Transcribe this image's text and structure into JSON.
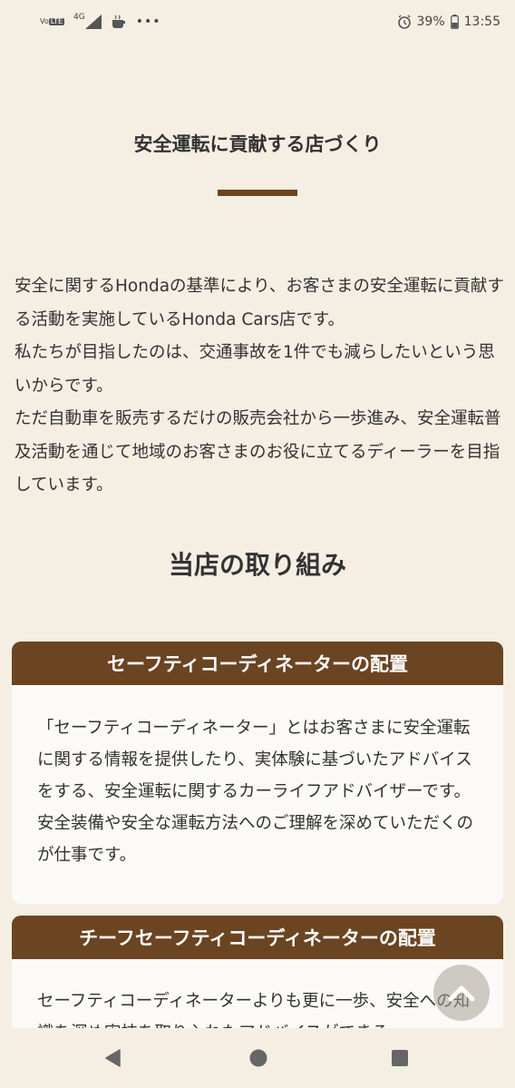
{
  "status_bar": {
    "volte_top": "Vo",
    "volte_bottom": "LTE",
    "network": "4G",
    "more": "•••",
    "battery_percent": "39%",
    "time": "13:55"
  },
  "page": {
    "section_title": "安全運転に貢献する店づくり",
    "intro_paragraphs": [
      "安全に関するHondaの基準により、お客さまの安全運転に貢献する活動を実施しているHonda Cars店です。",
      "私たちが目指したのは、交通事故を1件でも減らしたいという思いからです。",
      "ただ自動車を販売するだけの販売会社から一歩進み、安全運転普及活動を通じて地域のお客さまのお役に立てるディーラーを目指しています。"
    ],
    "sub_heading": "当店の取り組み",
    "cards": [
      {
        "title": "セーフティコーディネーターの配置",
        "body": "「セーフティコーディネーター」とはお客さまに安全運転に関する情報を提供したり、実体験に基づいたアドバイスをする、安全運転に関するカーライフアドバイザーです。安全装備や安全な運転方法へのご理解を深めていただくのが仕事です。"
      },
      {
        "title": "チーフセーフティコーディネーターの配置",
        "body": "セーフティコーディネーターよりも更に一歩、安全への知識を深め実技を取り入れたアドバイスができる"
      }
    ]
  },
  "icons": {
    "scroll_top": "chevron-up-icon",
    "nav_back": "triangle-back-icon",
    "nav_home": "circle-home-icon",
    "nav_recent": "square-recent-icon"
  },
  "colors": {
    "background": "#f5eee3",
    "accent_brown": "#6b4421",
    "card_background": "#fbfaf8"
  }
}
